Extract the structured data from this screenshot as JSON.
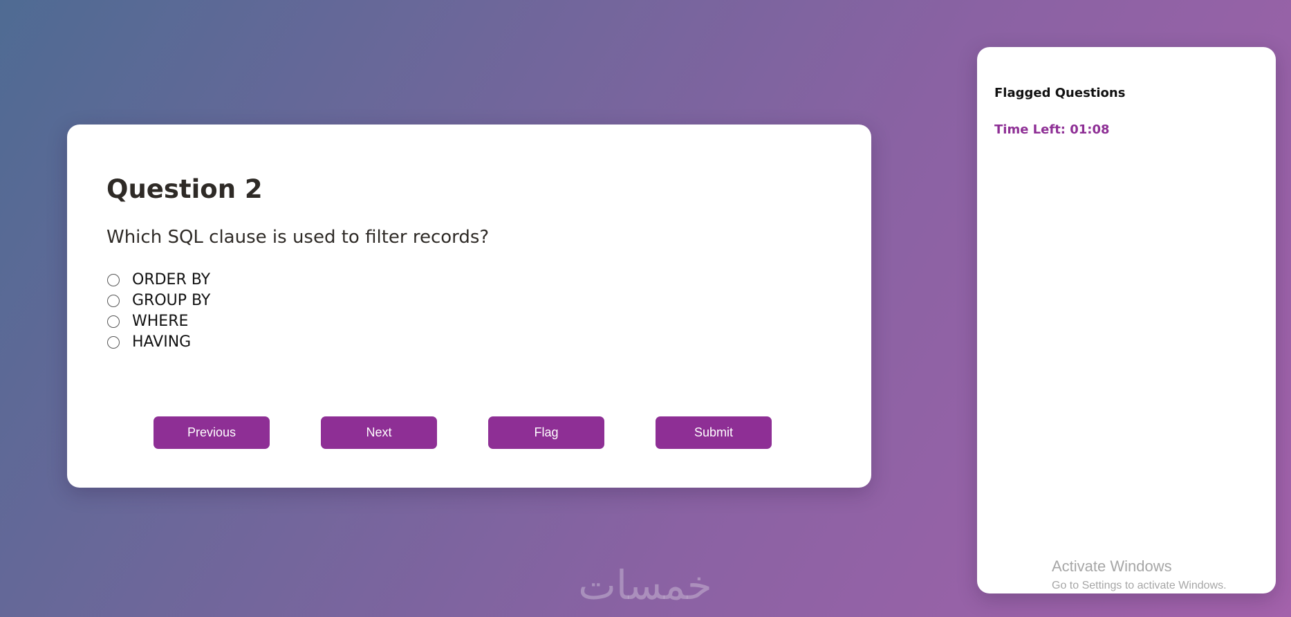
{
  "quiz": {
    "question_number": "Question 2",
    "question_text": "Which SQL clause is used to filter records?",
    "options": [
      "ORDER BY",
      "GROUP BY",
      "WHERE",
      "HAVING"
    ],
    "buttons": {
      "previous": "Previous",
      "next": "Next",
      "flag": "Flag",
      "submit": "Submit"
    }
  },
  "side_panel": {
    "title": "Flagged Questions",
    "timer": "Time Left: 01:08"
  },
  "os_overlay": {
    "activate_title": "Activate Windows",
    "activate_sub": "Go to Settings to activate Windows."
  },
  "watermark": {
    "text": "خمسات"
  },
  "colors": {
    "accent": "#8e2f95",
    "background_start": "#4f6b93",
    "background_end": "#a362ab"
  }
}
